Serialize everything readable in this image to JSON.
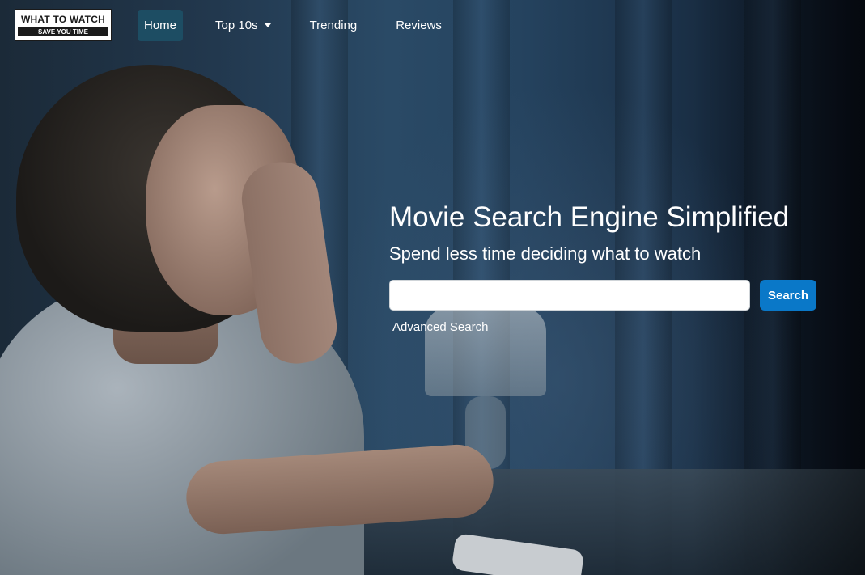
{
  "brand": {
    "line1": "WHAT TO WATCH",
    "line2": "SAVE YOU TIME"
  },
  "nav": {
    "items": [
      {
        "label": "Home",
        "active": true
      },
      {
        "label": "Top 10s",
        "dropdown": true
      },
      {
        "label": "Trending"
      },
      {
        "label": "Reviews"
      }
    ]
  },
  "hero": {
    "headline": "Movie Search Engine Simplified",
    "subheadline": "Spend less time deciding what to watch",
    "search": {
      "value": "",
      "placeholder": "",
      "button_label": "Search"
    },
    "advanced_link": "Advanced Search",
    "background_image": "woman-watching-tv-at-night"
  },
  "colors": {
    "active_nav": "#1d4d63",
    "search_button": "#0a78c8",
    "text": "#ffffff"
  }
}
